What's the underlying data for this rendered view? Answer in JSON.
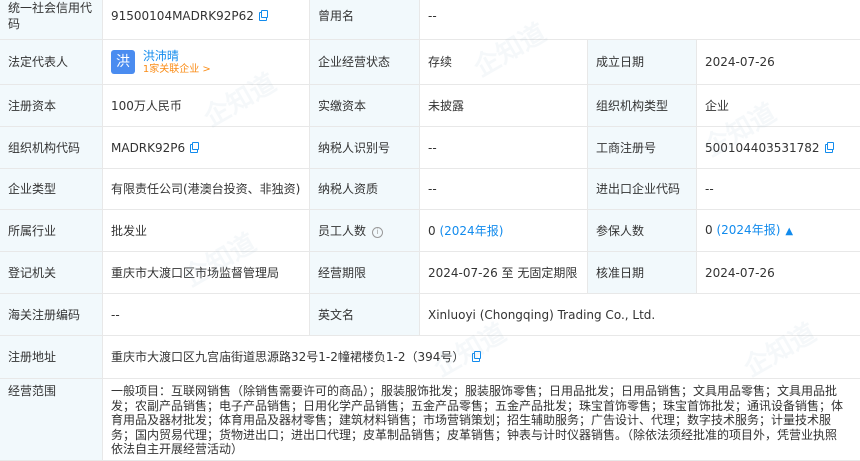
{
  "rows": [
    {
      "l1": "统一社会信用代码",
      "v1": "91500104MADRK92P62",
      "l2": "曾用名",
      "v2": "--"
    },
    {
      "l1": "法定代表人",
      "rep_avatar": "洪",
      "rep_name": "洪沛晴",
      "rep_relation": "1家关联企业 >",
      "l2": "企业经营状态",
      "v2": "存续",
      "l3": "成立日期",
      "v3": "2024-07-26"
    },
    {
      "l1": "注册资本",
      "v1": "100万人民币",
      "l2": "实缴资本",
      "v2": "未披露",
      "l3": "组织机构类型",
      "v3": "企业"
    },
    {
      "l1": "组织机构代码",
      "v1": "MADRK92P6",
      "l2": "纳税人识别号",
      "v2": "--",
      "l3": "工商注册号",
      "v3": "500104403531782"
    },
    {
      "l1": "企业类型",
      "v1": "有限责任公司(港澳台投资、非独资)",
      "l2": "纳税人资质",
      "v2": "--",
      "l3": "进出口企业代码",
      "v3": "--"
    },
    {
      "l1": "所属行业",
      "v1": "批发业",
      "l2": "员工人数",
      "v2": "0",
      "v2_year": "(2024年报)",
      "l3": "参保人数",
      "v3": "0",
      "v3_year": "(2024年报)"
    },
    {
      "l1": "登记机关",
      "v1": "重庆市大渡口区市场监督管理局",
      "l2": "经营期限",
      "v2": "2024-07-26 至 无固定期限",
      "l3": "核准日期",
      "v3": "2024-07-26"
    },
    {
      "l1": "海关注册编码",
      "v1": "--",
      "l2": "英文名",
      "v2": "Xinluoyi (Chongqing) Trading Co., Ltd."
    },
    {
      "l1": "注册地址",
      "v1": "重庆市大渡口区九宫庙街道思源路32号1-2幢裙楼负1-2（394号）"
    },
    {
      "l1": "经营范围",
      "v1": "一般项目：互联网销售（除销售需要许可的商品）；服装服饰批发；服装服饰零售；日用品批发；日用品销售；文具用品零售；文具用品批发；农副产品销售；电子产品销售；日用化学产品销售；五金产品零售；五金产品批发；珠宝首饰零售；珠宝首饰批发；通讯设备销售；体育用品及器材批发；体育用品及器材零售；建筑材料销售；市场营销策划；招生辅助服务；广告设计、代理；数字技术服务；计量技术服务；国内贸易代理；货物进出口；进出口代理；皮革制品销售；皮革销售；钟表与计时仪器销售。（除依法须经批准的项目外，凭营业执照依法自主开展经营活动）"
    }
  ],
  "watermark": "企知道",
  "icons": {
    "copy": "copy-icon",
    "info": "info-icon",
    "chart": "trend-chart-icon"
  }
}
